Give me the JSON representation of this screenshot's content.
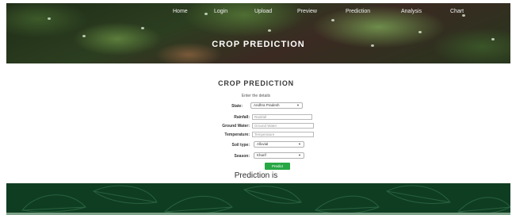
{
  "nav": [
    "Home",
    "Login",
    "Upload",
    "Preview",
    "Prediction",
    "Analysis",
    "Chart"
  ],
  "hero": {
    "title": "CROP PREDICTION"
  },
  "form": {
    "title": "CROP PREDICTION",
    "subtitle": "Enter the details",
    "state": {
      "label": "State:",
      "value": "Andhra Pradesh"
    },
    "rainfall": {
      "label": "Rainfall:",
      "placeholder": "Rainfall"
    },
    "groundwater": {
      "label": "Ground Water:",
      "placeholder": "Ground Water"
    },
    "temperature": {
      "label": "Temperature:",
      "placeholder": "Temperature"
    },
    "soil": {
      "label": "Soil type:",
      "value": "Alluvial"
    },
    "season": {
      "label": "Season:",
      "value": "Kharif"
    },
    "submit_label": "Predict"
  },
  "result": {
    "text": "Prediction is"
  },
  "colors": {
    "predict_button": "#28a745",
    "footer": "#0f3d22"
  },
  "icons": {
    "dropdown": "chevron-down-icon"
  }
}
